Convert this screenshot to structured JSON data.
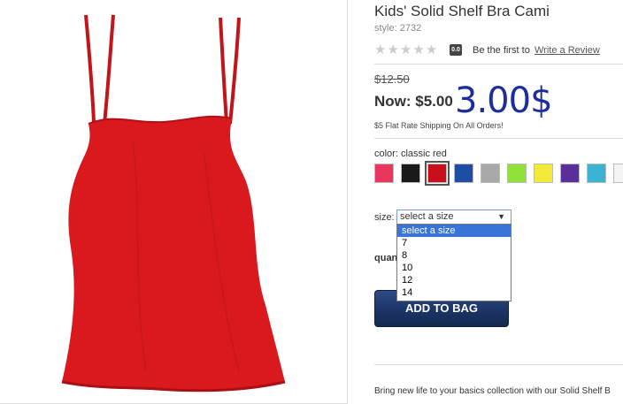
{
  "product": {
    "title": "Kids' Solid Shelf Bra Cami",
    "style": "style: 2732",
    "rating": {
      "stars_filled": 0,
      "stars_total": 5,
      "score": "0.0",
      "prompt": "Be the first to",
      "review_link": "Write a Review"
    },
    "price": {
      "old": "$12.50",
      "now": "Now: $5.00",
      "overlay": "3.00$"
    },
    "shipping": "$5 Flat Rate Shipping On All Orders!",
    "color_label": "color: classic red",
    "swatches": [
      {
        "name": "pink",
        "color": "#e8365d",
        "selected": false
      },
      {
        "name": "black",
        "color": "#1a1a1a",
        "selected": false
      },
      {
        "name": "classic red",
        "color": "#c8101c",
        "selected": true
      },
      {
        "name": "blue",
        "color": "#1d4ea3",
        "selected": false
      },
      {
        "name": "gray",
        "color": "#a9a9a9",
        "selected": false
      },
      {
        "name": "lime",
        "color": "#8ee23a",
        "selected": false
      },
      {
        "name": "yellow",
        "color": "#f4ea3c",
        "selected": false
      },
      {
        "name": "purple",
        "color": "#5a2f9c",
        "selected": false
      },
      {
        "name": "aqua",
        "color": "#3ab3d4",
        "selected": false
      },
      {
        "name": "white",
        "color": "#f4f4f4",
        "selected": false
      }
    ],
    "size_label": "size:",
    "size_select_value": "select a size",
    "size_options": [
      "select a size",
      "7",
      "8",
      "10",
      "12",
      "14"
    ],
    "qty_label": "quan",
    "add_button": "ADD TO BAG",
    "description": "Bring new life to your basics collection with our Solid Shelf B"
  },
  "colors": {
    "garment": "#d9191e",
    "button": "#1c3567",
    "overlay_price": "#1c2d9e",
    "dropdown_highlight": "#3875d7"
  },
  "icons": {
    "star": "star-icon",
    "caret": "caret-down-icon"
  }
}
